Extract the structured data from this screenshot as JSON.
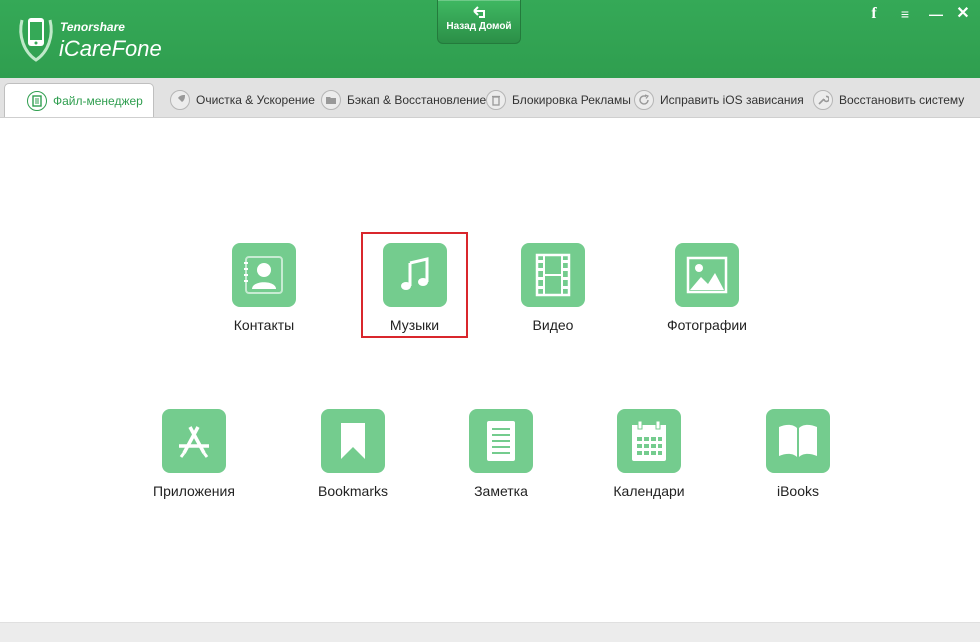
{
  "app": {
    "vendor": "Tenorshare",
    "name": "iCareFone",
    "home_button": "Назад Домой"
  },
  "window_controls": {
    "facebook": "f",
    "menu": "≡",
    "minimize": "—",
    "close": "✕"
  },
  "tabs": [
    {
      "label": "Файл-менеджер",
      "icon": "file-manager-icon",
      "active": true
    },
    {
      "label": "Очистка & Ускорение",
      "icon": "rocket-icon",
      "active": false
    },
    {
      "label": "Бэкап & Восстановление",
      "icon": "folder-icon",
      "active": false
    },
    {
      "label": "Блокировка Рекламы",
      "icon": "trash-icon",
      "active": false
    },
    {
      "label": "Исправить iOS зависания",
      "icon": "refresh-icon",
      "active": false
    },
    {
      "label": "Восстановить систему",
      "icon": "wrench-icon",
      "active": false
    }
  ],
  "categories": [
    {
      "label": "Контакты",
      "icon": "contacts-icon"
    },
    {
      "label": "Музыки",
      "icon": "music-icon",
      "selected": true
    },
    {
      "label": "Видео",
      "icon": "video-icon"
    },
    {
      "label": "Фотографии",
      "icon": "photos-icon"
    },
    {
      "label": "Приложения",
      "icon": "apps-icon"
    },
    {
      "label": "Bookmarks",
      "icon": "bookmark-icon"
    },
    {
      "label": "Заметка",
      "icon": "notes-icon"
    },
    {
      "label": "Календари",
      "icon": "calendar-icon"
    },
    {
      "label": "iBooks",
      "icon": "book-icon"
    }
  ],
  "colors": {
    "header_green": "#2f9e4f",
    "tile_green": "#74cc8e",
    "selection_red": "#d9262c"
  }
}
